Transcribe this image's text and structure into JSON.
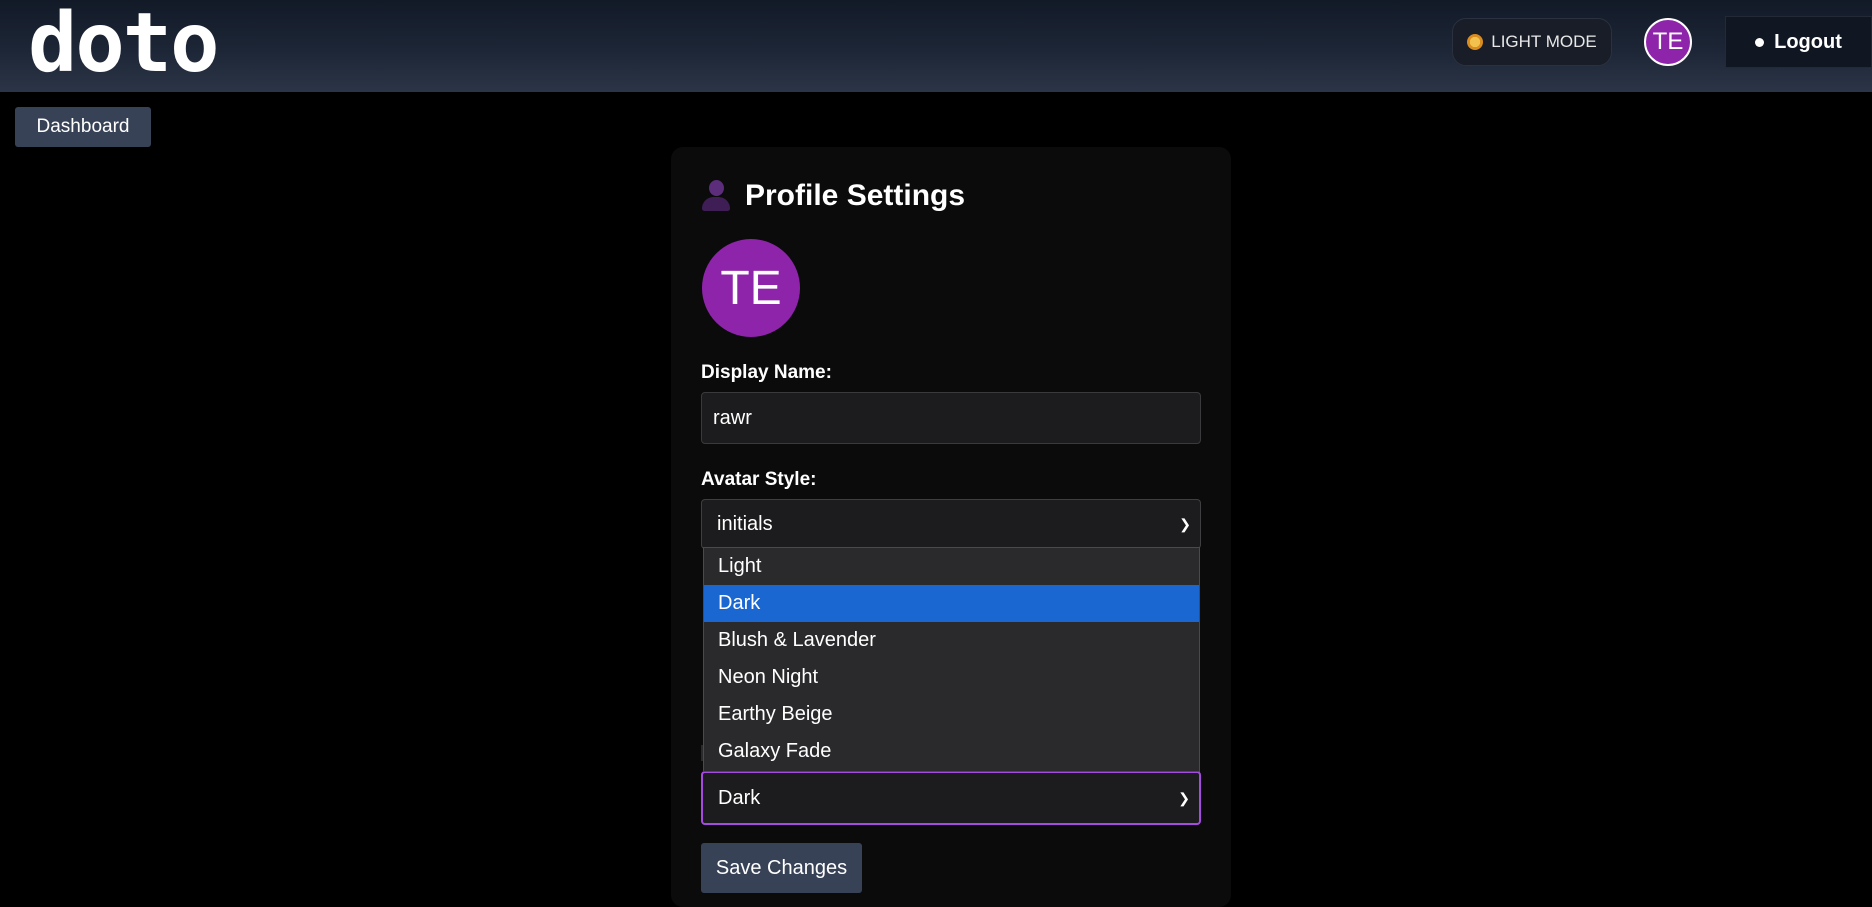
{
  "header": {
    "logo": "doto",
    "mode_toggle_label": "LIGHT MODE",
    "user_initials": "TE",
    "logout_label": "Logout"
  },
  "nav": {
    "dashboard_label": "Dashboard"
  },
  "profile": {
    "title": "Profile Settings",
    "avatar_initials": "TE",
    "display_name_label": "Display Name:",
    "display_name_value": "rawr",
    "avatar_style_label": "Avatar Style:",
    "avatar_style_value": "initials",
    "theme_value": "Dark",
    "theme_options": [
      "Light",
      "Dark",
      "Blush & Lavender",
      "Neon Night",
      "Earthy Beige",
      "Galaxy Fade"
    ],
    "theme_selected_index": 1,
    "save_label": "Save Changes"
  },
  "colors": {
    "avatar": "#8e24aa",
    "focus_border": "#a64be0",
    "selected_option": "#1a67d2",
    "button": "#374257"
  }
}
